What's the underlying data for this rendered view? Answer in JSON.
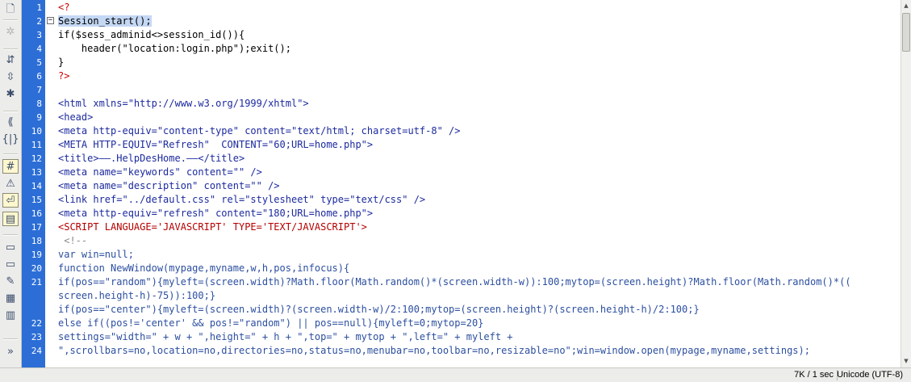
{
  "toolbar": {
    "items": [
      {
        "name": "new-document-icon",
        "glyph": "🗋"
      },
      {
        "name": "settings-gear-icon",
        "glyph": "✲"
      },
      {
        "name": "collapse-tags-icon",
        "glyph": "⇵"
      },
      {
        "name": "collapse-selection-icon",
        "glyph": "⇳"
      },
      {
        "name": "expand-all-icon",
        "glyph": "✱"
      },
      {
        "name": "select-parent-tag-icon",
        "glyph": "⟪"
      },
      {
        "name": "balance-braces-icon",
        "glyph": "{|}"
      },
      {
        "name": "line-numbers-icon",
        "glyph": "#"
      },
      {
        "name": "highlight-invalid-code-icon",
        "glyph": "⚠"
      },
      {
        "name": "word-wrap-icon",
        "glyph": "⏎"
      },
      {
        "name": "syntax-coloring-icon",
        "glyph": "▤"
      },
      {
        "name": "apply-comment-icon",
        "glyph": "▭"
      },
      {
        "name": "remove-comment-icon",
        "glyph": "▭"
      },
      {
        "name": "wrap-tag-icon",
        "glyph": "✎"
      },
      {
        "name": "recent-snippets-icon",
        "glyph": "▦"
      },
      {
        "name": "move-css-icon",
        "glyph": "▥"
      },
      {
        "name": "more-options-icon",
        "glyph": "»"
      }
    ]
  },
  "editor": {
    "line_numbers": [
      "1",
      "2",
      "3",
      "4",
      "5",
      "6",
      "7",
      "8",
      "9",
      "10",
      "11",
      "12",
      "13",
      "14",
      "15",
      "16",
      "17",
      "18",
      "19",
      "20",
      "21",
      "",
      "22",
      "23",
      "24"
    ],
    "lines": [
      "<?",
      "Session_start();",
      "if($sess_adminid<>session_id()){",
      "    header(\"location:login.php\");exit();",
      "}",
      "?>",
      "",
      "<html xmlns=\"http://www.w3.org/1999/xhtml\">",
      "<head>",
      "<meta http-equiv=\"content-type\" content=\"text/html; charset=utf-8\" />",
      "<META HTTP-EQUIV=\"Refresh\"  CONTENT=\"60;URL=home.php\">",
      "<title>——.HelpDesHome.——</title>",
      "<meta name=\"keywords\" content=\"\" />",
      "<meta name=\"description\" content=\"\" />",
      "<link href=\"../default.css\" rel=\"stylesheet\" type=\"text/css\" />",
      "<meta http-equiv=\"refresh\" content=\"180;URL=home.php\">",
      "<SCRIPT LANGUAGE='JAVASCRIPT' TYPE='TEXT/JAVASCRIPT'>",
      " <!--",
      "var win=null;",
      "function NewWindow(mypage,myname,w,h,pos,infocus){",
      "if(pos==\"random\"){myleft=(screen.width)?Math.floor(Math.random()*(screen.width-w)):100;mytop=(screen.height)?Math.floor(Math.random()*((",
      "screen.height-h)-75)):100;}",
      "if(pos==\"center\"){myleft=(screen.width)?(screen.width-w)/2:100;mytop=(screen.height)?(screen.height-h)/2:100;}",
      "else if((pos!='center' && pos!=\"random\") || pos==null){myleft=0;mytop=20}",
      "settings=\"width=\" + w + \",height=\" + h + \",top=\" + mytop + \",left=\" + myleft +",
      "\",scrollbars=no,location=no,directories=no,status=no,menubar=no,toolbar=no,resizable=no\";win=window.open(mypage,myname,settings);"
    ]
  },
  "status": {
    "size": "7K / 1 sec",
    "encoding": "Unicode (UTF-8)"
  },
  "colors": {
    "gutter": "#2c6ed6",
    "selection": "#c4d8f4",
    "php_delim": "#cc0000",
    "tag": "#1c2a9e",
    "string": "#b50000"
  }
}
